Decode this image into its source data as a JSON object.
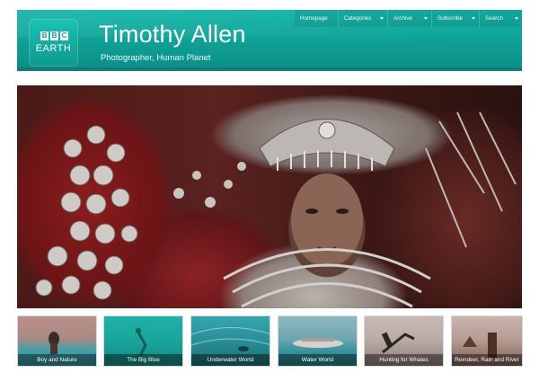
{
  "header": {
    "logo": {
      "top_text": [
        "B",
        "B",
        "C"
      ],
      "bottom_text": "EARTH"
    },
    "title": "Timothy Allen",
    "subtitle": "Photographer, Human Planet"
  },
  "nav": {
    "items": [
      {
        "label": "Homepage",
        "has_dropdown": false
      },
      {
        "label": "Categories",
        "has_dropdown": true
      },
      {
        "label": "Archive",
        "has_dropdown": true
      },
      {
        "label": "Subscribe",
        "has_dropdown": true
      },
      {
        "label": "Search",
        "has_dropdown": true
      }
    ]
  },
  "hero": {
    "icon": "hero-photo"
  },
  "thumbnails": [
    {
      "caption": "Boy and Nature"
    },
    {
      "caption": "The Big Blue"
    },
    {
      "caption": "Underwater World"
    },
    {
      "caption": "Water World"
    },
    {
      "caption": "Hunting for Whales"
    },
    {
      "caption": "Reindeer, Rain and River"
    }
  ],
  "colors": {
    "header_teal": "#13b6a9",
    "header_dark": "#0b7f77",
    "text_white": "#ffffff"
  }
}
